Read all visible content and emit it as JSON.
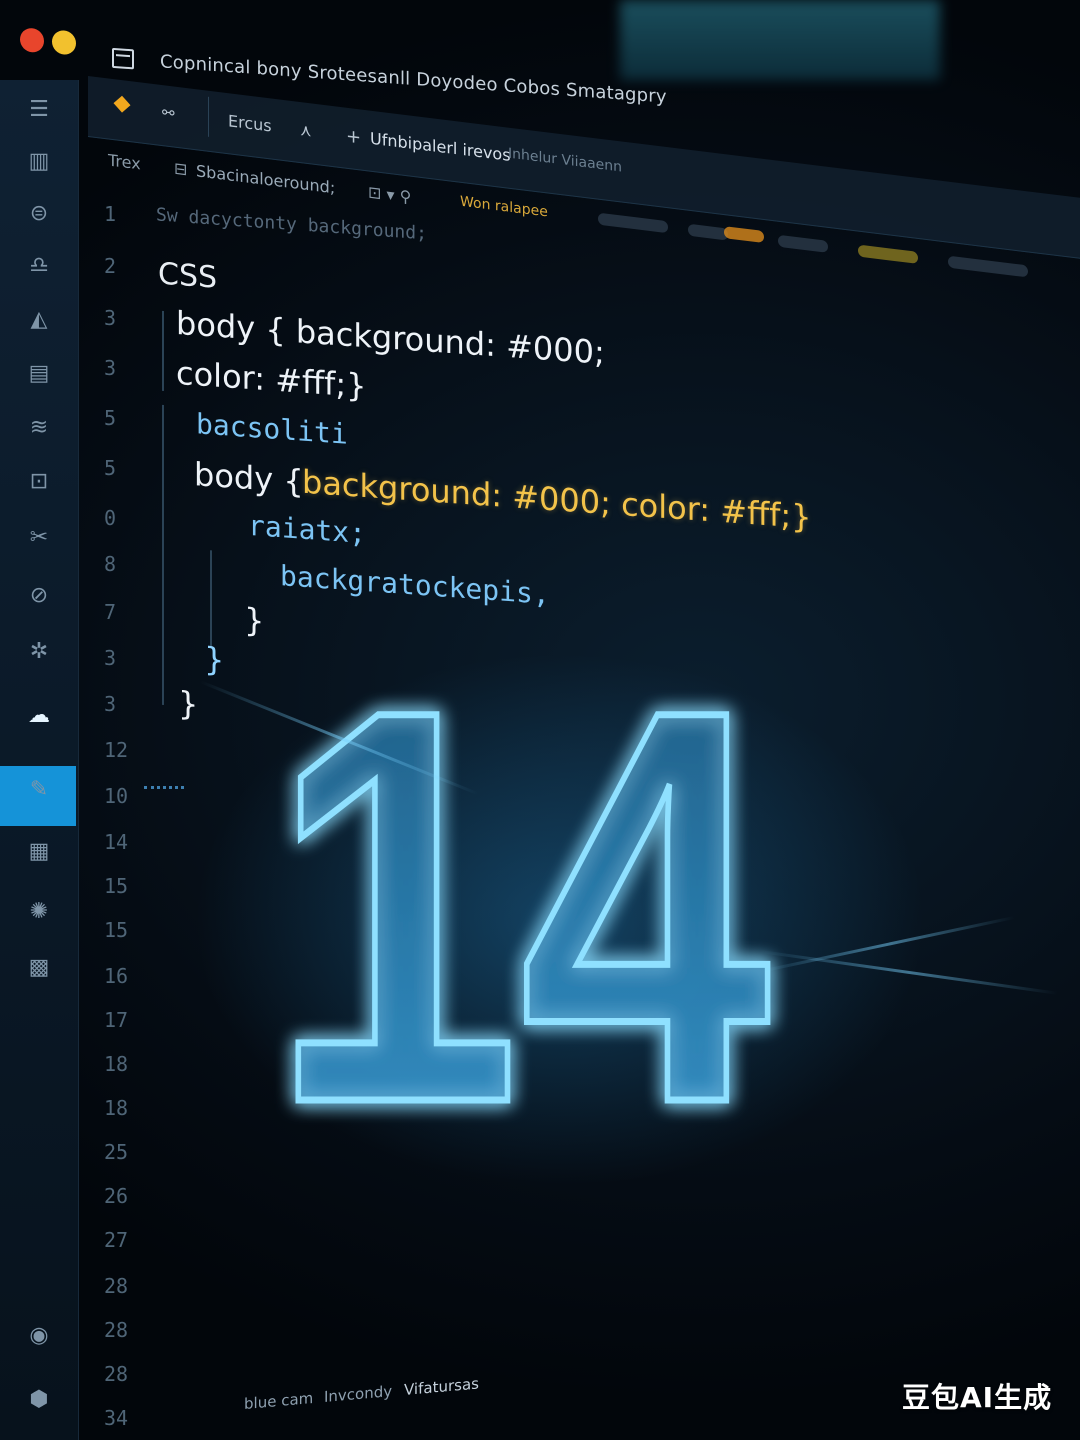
{
  "window": {
    "title": "Copnincal bony Sroteesanll Doyodeo Cobos Smatagpry"
  },
  "tabs": [
    {
      "label": "Ercus"
    },
    {
      "label": "Ufnbipalerl irevos"
    },
    {
      "label": "Inhelur Viiaaenn"
    }
  ],
  "breadcrumb": {
    "root": "Trex",
    "file": "Sbacinaloeround;",
    "extra": "Won ralapee"
  },
  "gutter": {
    "line_numbers": [
      "1",
      "2",
      "3",
      "3",
      "5",
      "5",
      "0",
      "8",
      "7",
      "3",
      "3",
      "12",
      "10",
      "14",
      "15",
      "15",
      "16",
      "17",
      "18",
      "18",
      "25",
      "26",
      "27",
      "28",
      "28",
      "28",
      "34"
    ]
  },
  "code": {
    "comment": "Sw dacyctonty background;",
    "lang": "CSS",
    "l1": "body { background: #000;",
    "l2": "color: #fff;}",
    "l3": "bacsoliti",
    "l4a": "body {",
    "l4b": "background: #000; color: #fff;}",
    "l5": "raiatx;",
    "l6": "backgratockepis,",
    "l7": "}",
    "l8": "}",
    "l9": "}"
  },
  "hero": {
    "number": "14"
  },
  "statusbar": {
    "items": [
      "blue cam",
      "Invcondy",
      "Vifatursas"
    ]
  },
  "watermark": "豆包AI生成",
  "colors": {
    "accent": "#1593d8",
    "neon": "#6fd2ff",
    "keyword": "#e8eef4",
    "string_yellow": "#f3c34a",
    "property_blue": "#7cc4f4"
  }
}
